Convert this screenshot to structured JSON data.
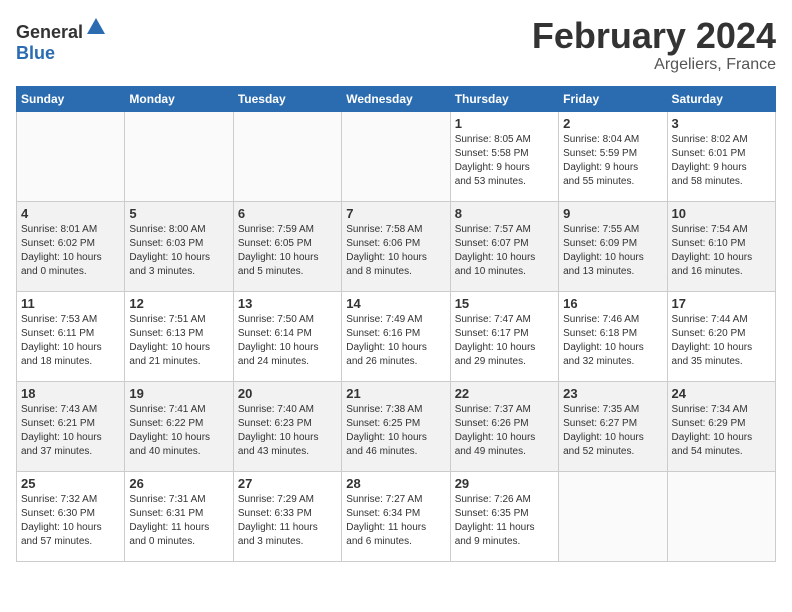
{
  "header": {
    "logo_general": "General",
    "logo_blue": "Blue",
    "month": "February 2024",
    "location": "Argeliers, France"
  },
  "days_of_week": [
    "Sunday",
    "Monday",
    "Tuesday",
    "Wednesday",
    "Thursday",
    "Friday",
    "Saturday"
  ],
  "weeks": [
    [
      {
        "day": "",
        "info": ""
      },
      {
        "day": "",
        "info": ""
      },
      {
        "day": "",
        "info": ""
      },
      {
        "day": "",
        "info": ""
      },
      {
        "day": "1",
        "info": "Sunrise: 8:05 AM\nSunset: 5:58 PM\nDaylight: 9 hours\nand 53 minutes."
      },
      {
        "day": "2",
        "info": "Sunrise: 8:04 AM\nSunset: 5:59 PM\nDaylight: 9 hours\nand 55 minutes."
      },
      {
        "day": "3",
        "info": "Sunrise: 8:02 AM\nSunset: 6:01 PM\nDaylight: 9 hours\nand 58 minutes."
      }
    ],
    [
      {
        "day": "4",
        "info": "Sunrise: 8:01 AM\nSunset: 6:02 PM\nDaylight: 10 hours\nand 0 minutes."
      },
      {
        "day": "5",
        "info": "Sunrise: 8:00 AM\nSunset: 6:03 PM\nDaylight: 10 hours\nand 3 minutes."
      },
      {
        "day": "6",
        "info": "Sunrise: 7:59 AM\nSunset: 6:05 PM\nDaylight: 10 hours\nand 5 minutes."
      },
      {
        "day": "7",
        "info": "Sunrise: 7:58 AM\nSunset: 6:06 PM\nDaylight: 10 hours\nand 8 minutes."
      },
      {
        "day": "8",
        "info": "Sunrise: 7:57 AM\nSunset: 6:07 PM\nDaylight: 10 hours\nand 10 minutes."
      },
      {
        "day": "9",
        "info": "Sunrise: 7:55 AM\nSunset: 6:09 PM\nDaylight: 10 hours\nand 13 minutes."
      },
      {
        "day": "10",
        "info": "Sunrise: 7:54 AM\nSunset: 6:10 PM\nDaylight: 10 hours\nand 16 minutes."
      }
    ],
    [
      {
        "day": "11",
        "info": "Sunrise: 7:53 AM\nSunset: 6:11 PM\nDaylight: 10 hours\nand 18 minutes."
      },
      {
        "day": "12",
        "info": "Sunrise: 7:51 AM\nSunset: 6:13 PM\nDaylight: 10 hours\nand 21 minutes."
      },
      {
        "day": "13",
        "info": "Sunrise: 7:50 AM\nSunset: 6:14 PM\nDaylight: 10 hours\nand 24 minutes."
      },
      {
        "day": "14",
        "info": "Sunrise: 7:49 AM\nSunset: 6:16 PM\nDaylight: 10 hours\nand 26 minutes."
      },
      {
        "day": "15",
        "info": "Sunrise: 7:47 AM\nSunset: 6:17 PM\nDaylight: 10 hours\nand 29 minutes."
      },
      {
        "day": "16",
        "info": "Sunrise: 7:46 AM\nSunset: 6:18 PM\nDaylight: 10 hours\nand 32 minutes."
      },
      {
        "day": "17",
        "info": "Sunrise: 7:44 AM\nSunset: 6:20 PM\nDaylight: 10 hours\nand 35 minutes."
      }
    ],
    [
      {
        "day": "18",
        "info": "Sunrise: 7:43 AM\nSunset: 6:21 PM\nDaylight: 10 hours\nand 37 minutes."
      },
      {
        "day": "19",
        "info": "Sunrise: 7:41 AM\nSunset: 6:22 PM\nDaylight: 10 hours\nand 40 minutes."
      },
      {
        "day": "20",
        "info": "Sunrise: 7:40 AM\nSunset: 6:23 PM\nDaylight: 10 hours\nand 43 minutes."
      },
      {
        "day": "21",
        "info": "Sunrise: 7:38 AM\nSunset: 6:25 PM\nDaylight: 10 hours\nand 46 minutes."
      },
      {
        "day": "22",
        "info": "Sunrise: 7:37 AM\nSunset: 6:26 PM\nDaylight: 10 hours\nand 49 minutes."
      },
      {
        "day": "23",
        "info": "Sunrise: 7:35 AM\nSunset: 6:27 PM\nDaylight: 10 hours\nand 52 minutes."
      },
      {
        "day": "24",
        "info": "Sunrise: 7:34 AM\nSunset: 6:29 PM\nDaylight: 10 hours\nand 54 minutes."
      }
    ],
    [
      {
        "day": "25",
        "info": "Sunrise: 7:32 AM\nSunset: 6:30 PM\nDaylight: 10 hours\nand 57 minutes."
      },
      {
        "day": "26",
        "info": "Sunrise: 7:31 AM\nSunset: 6:31 PM\nDaylight: 11 hours\nand 0 minutes."
      },
      {
        "day": "27",
        "info": "Sunrise: 7:29 AM\nSunset: 6:33 PM\nDaylight: 11 hours\nand 3 minutes."
      },
      {
        "day": "28",
        "info": "Sunrise: 7:27 AM\nSunset: 6:34 PM\nDaylight: 11 hours\nand 6 minutes."
      },
      {
        "day": "29",
        "info": "Sunrise: 7:26 AM\nSunset: 6:35 PM\nDaylight: 11 hours\nand 9 minutes."
      },
      {
        "day": "",
        "info": ""
      },
      {
        "day": "",
        "info": ""
      }
    ]
  ]
}
